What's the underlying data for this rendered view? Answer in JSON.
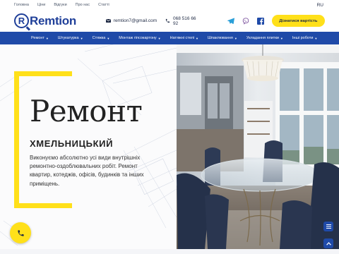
{
  "topbar": {
    "links": [
      "Головна",
      "Ціни",
      "Відгуки",
      "Про нас",
      "Статті"
    ],
    "language": "RU"
  },
  "header": {
    "logo_text": "Remtion",
    "logo_letter": "R",
    "email": "remtion7@gmail.com",
    "phone": "068 516 66 92",
    "socials": [
      "telegram-icon",
      "viber-icon",
      "facebook-icon"
    ],
    "cta_label": "Дізнатися вартість"
  },
  "nav": {
    "items": [
      "Ремонт",
      "Штукатурка",
      "Стяжка",
      "Монтаж гіпсокартону",
      "Натяжні стелі",
      "Шпаклювання",
      "Укладання плитки",
      "Інші роботи"
    ]
  },
  "hero": {
    "title": "Ремонт",
    "subtitle": "ХМЕЛЬНИЦЬКИЙ",
    "description": "Виконуємо абсолютно усі види внутрішніх ремонтно-оздоблювальних робіт. Ремонт квартир, котеджів, офісів, будинків та інших приміщень."
  },
  "floating": {
    "call_icon": "phone-icon",
    "menu_icon": "menu-icon",
    "scroll_icon": "chevron-up-icon"
  },
  "colors": {
    "brand_blue": "#1f4aa8",
    "accent_yellow": "#ffe01a"
  }
}
